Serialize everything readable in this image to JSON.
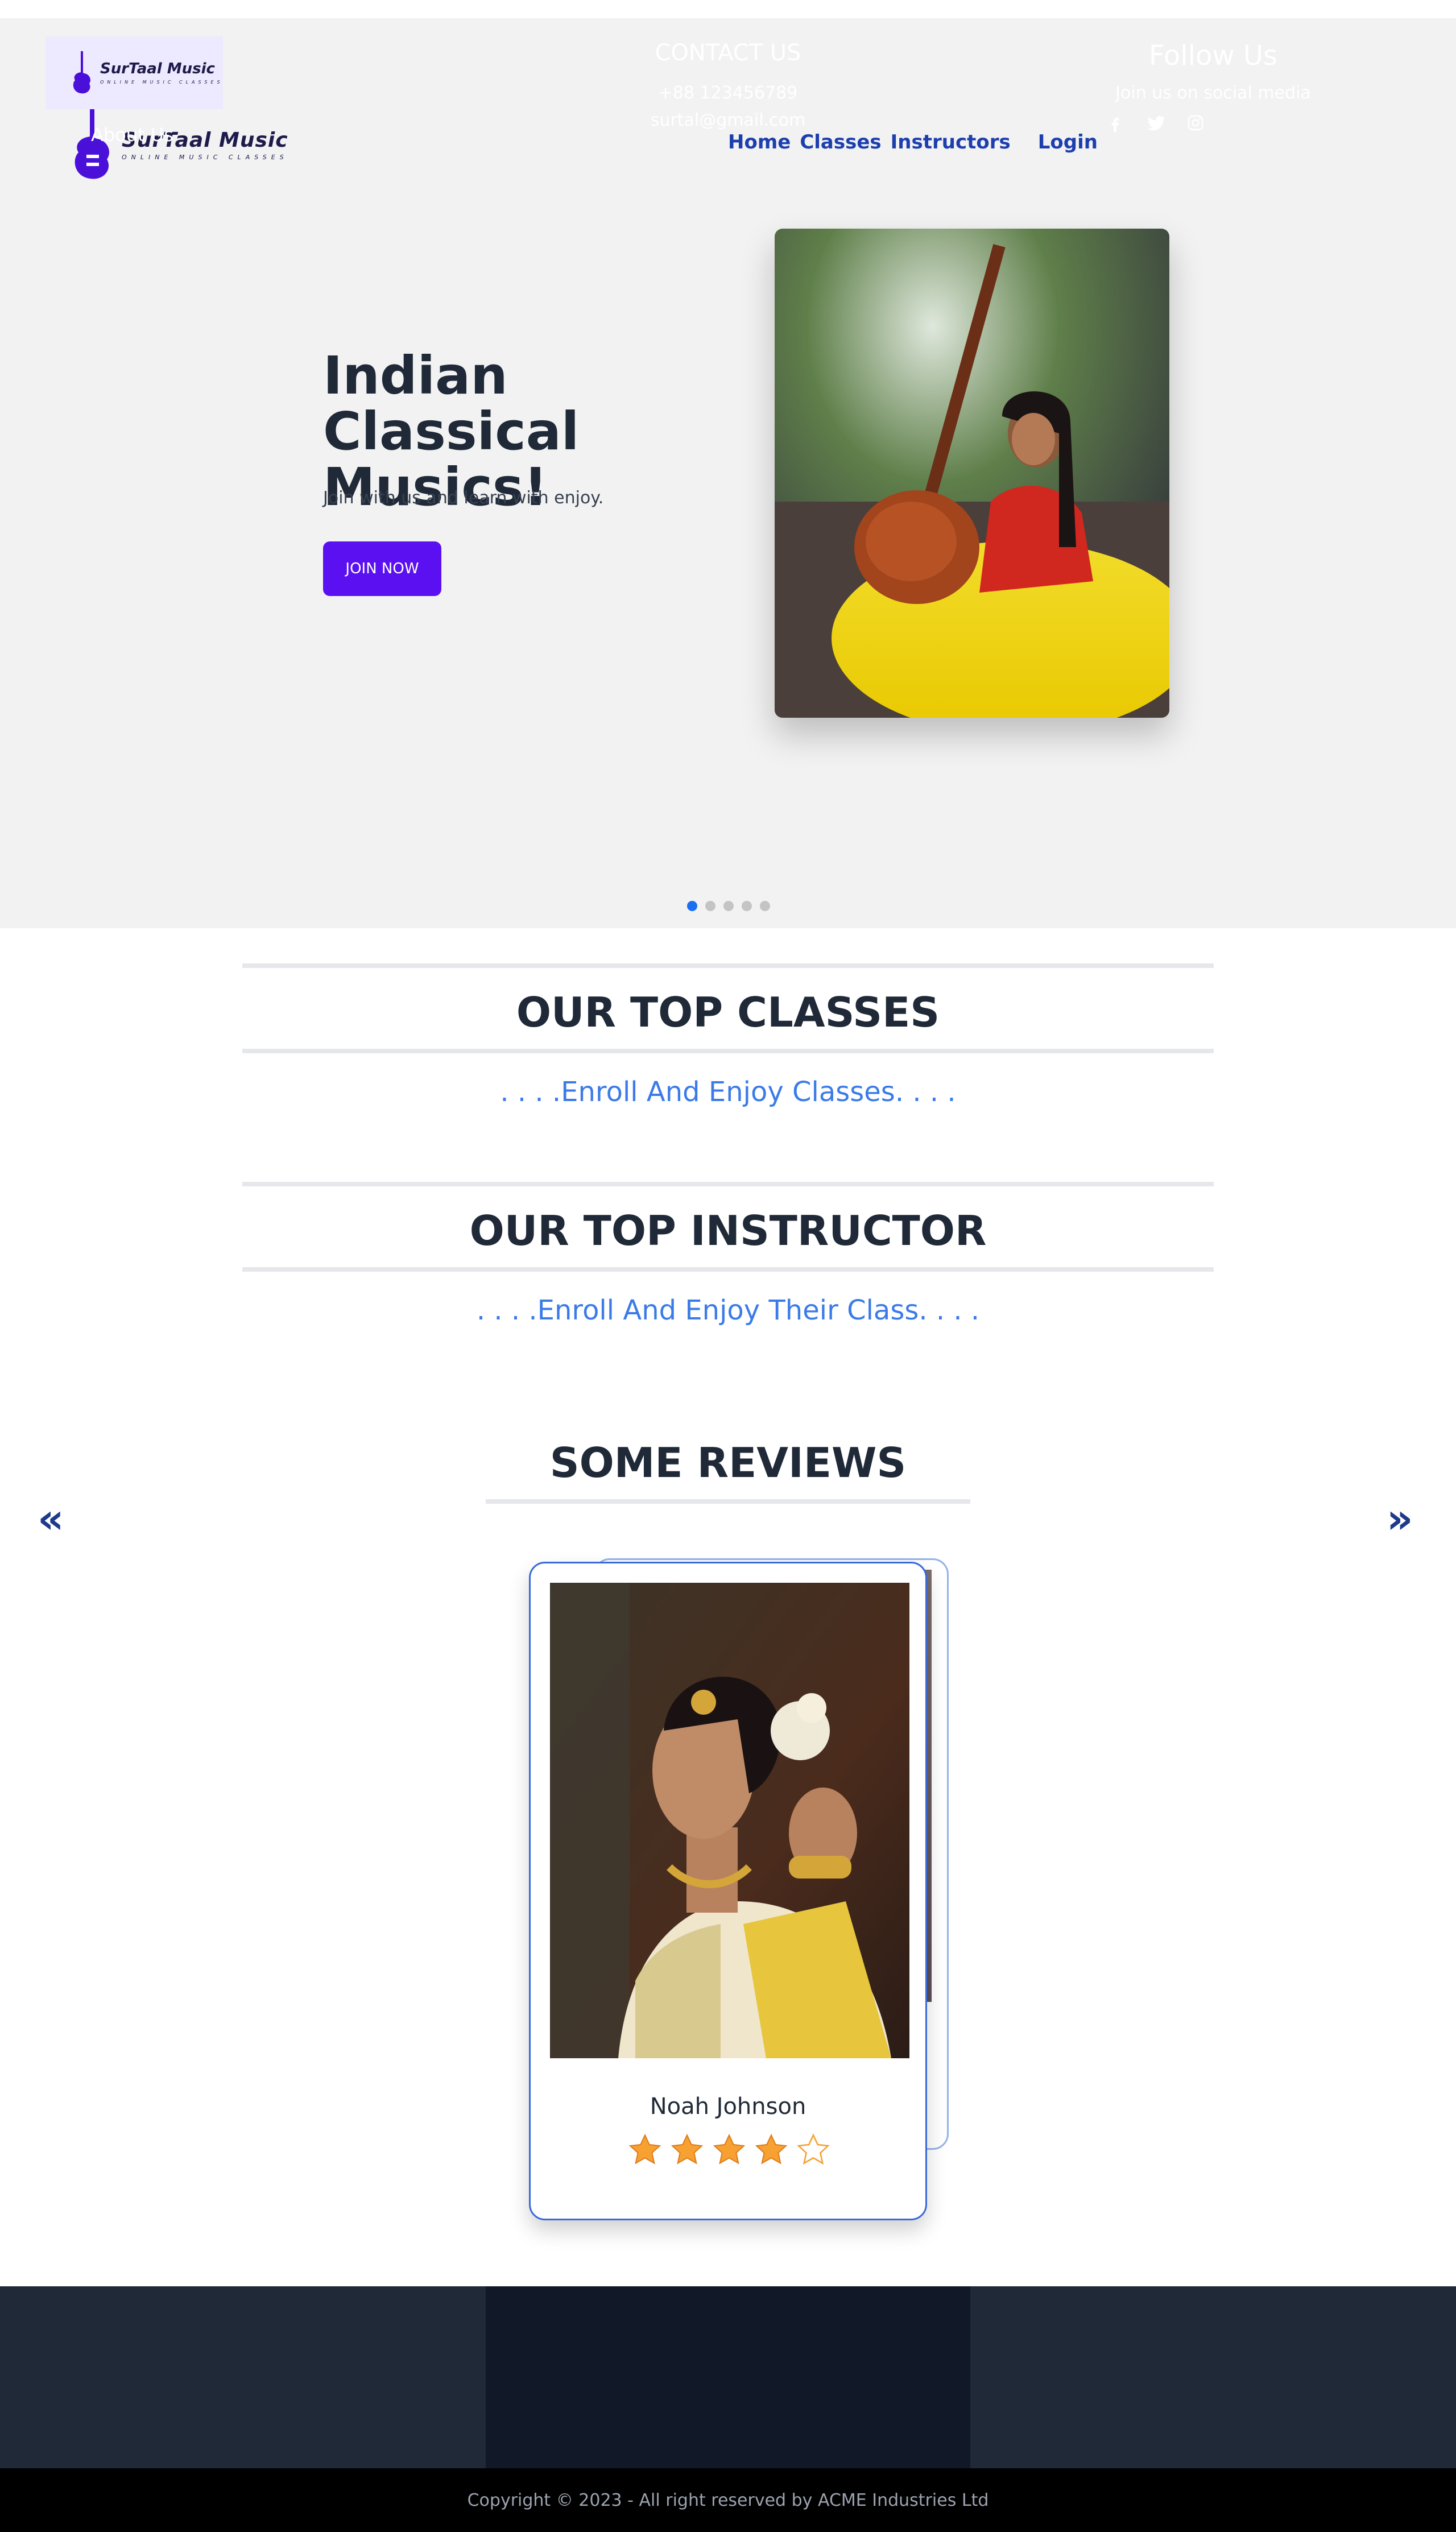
{
  "brand": {
    "name": "SurTaal Music",
    "tagline": "ONLINE MUSIC CLASSES",
    "accent_color": "#5a10f0"
  },
  "nav": {
    "items": [
      "Home",
      "Classes",
      "Instructors",
      "Login"
    ]
  },
  "hero": {
    "title": "Indian Classical Musics!",
    "subtitle": "Join with us and learn with enjoy.",
    "button_label": "JOIN NOW",
    "photo_icon": "woman-with-veena-photo",
    "slide_count": 5,
    "active_slide": 1
  },
  "classes_section": {
    "title": "OUR TOP CLASSES",
    "subtitle": ". . . .Enroll And Enjoy Classes. . . ."
  },
  "instructor_section": {
    "title": "OUR TOP INSTRUCTOR",
    "subtitle": ". . . .Enroll And Enjoy Their Class. . . ."
  },
  "reviews": {
    "title": "SOME REVIEWS",
    "prev_label": "«",
    "next_label": "»",
    "card": {
      "name": "Noah Johnson",
      "rating": 4,
      "rating_max": 5,
      "photo_icon": "woman-in-traditional-saree-photo"
    }
  },
  "footer": {
    "about_label": "About Us",
    "contact_title": "CONTACT US",
    "phone": "+88 123456789",
    "email": "surtal@gmail.com",
    "follow_title": "Follow Us",
    "follow_sub": "Join us on social media",
    "social_icons": [
      "facebook-icon",
      "twitter-icon",
      "instagram-icon"
    ],
    "copyright": "Copyright © 2023 - All right reserved by ACME Industries Ltd"
  }
}
